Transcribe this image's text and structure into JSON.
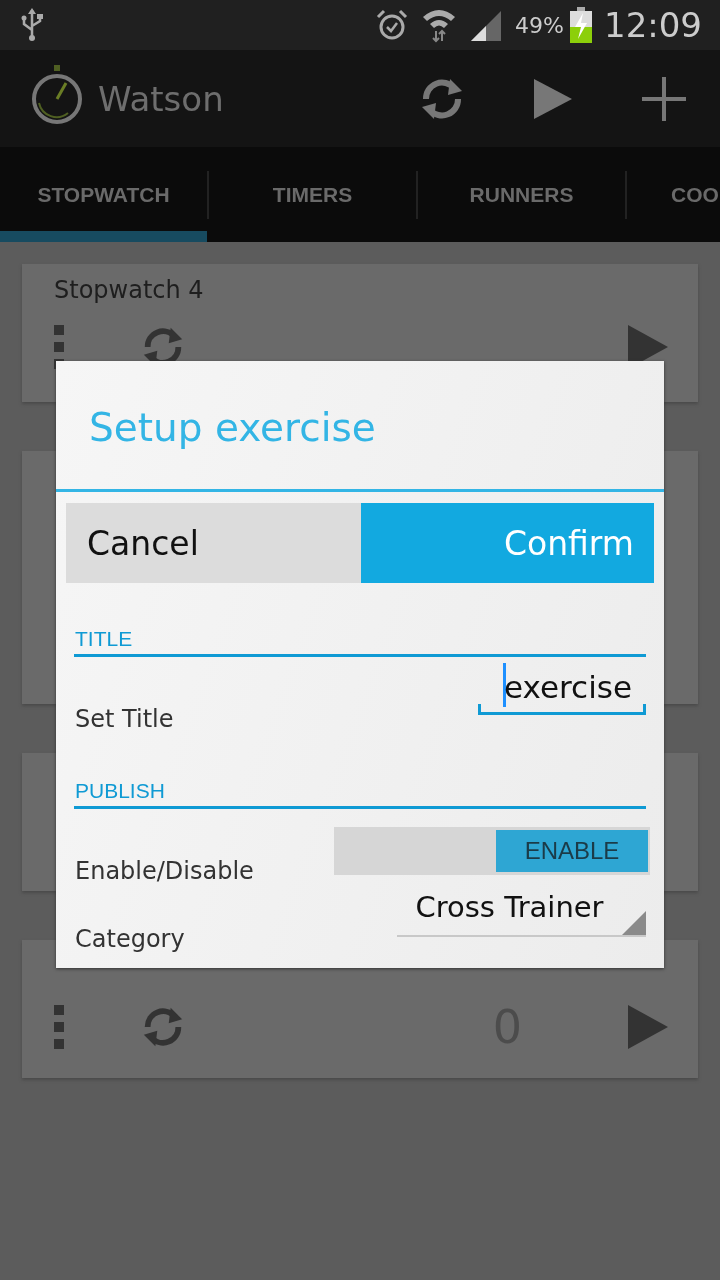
{
  "status_bar": {
    "battery": "49%",
    "time": "12:09"
  },
  "app_bar": {
    "title": "Watson"
  },
  "tabs": [
    {
      "label": "STOPWATCH",
      "selected": true
    },
    {
      "label": "TIMERS",
      "selected": false
    },
    {
      "label": "RUNNERS",
      "selected": false
    },
    {
      "label": "COO",
      "selected": false
    }
  ],
  "cards": [
    {
      "kind": "stopwatch",
      "title": "Stopwatch 4"
    },
    {
      "kind": "covered"
    },
    {
      "kind": "covered"
    },
    {
      "kind": "stopwatch",
      "value": "0"
    }
  ],
  "dialog": {
    "title": "Setup exercise",
    "cancel": "Cancel",
    "confirm": "Confirm",
    "sections": [
      {
        "header": "TITLE",
        "rows": [
          {
            "kind": "text",
            "label": "Set Title",
            "value": "exercise"
          }
        ]
      },
      {
        "header": "PUBLISH",
        "rows": [
          {
            "kind": "toggle",
            "label": "Enable/Disable",
            "toggle_label": "ENABLE",
            "on": true
          },
          {
            "kind": "dropdown",
            "label": "Category",
            "value": "Cross Trainer"
          }
        ]
      }
    ]
  }
}
